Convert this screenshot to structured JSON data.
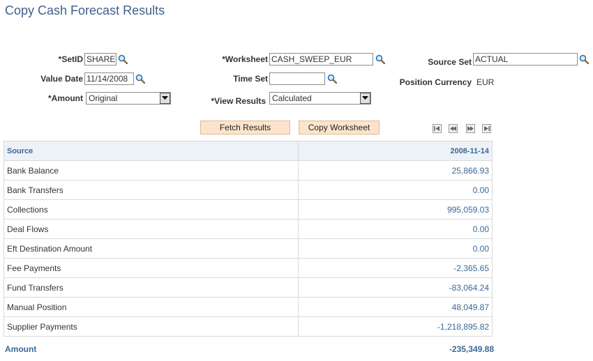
{
  "page": {
    "title": "Copy Cash Forecast Results"
  },
  "criteria": {
    "setid": {
      "label": "*SetID",
      "value": "SHARE"
    },
    "value_date": {
      "label": "Value Date",
      "value": "11/14/2008"
    },
    "amount": {
      "label": "*Amount",
      "value": "Original"
    },
    "worksheet": {
      "label": "*Worksheet",
      "value": "CASH_SWEEP_EUR"
    },
    "time_set": {
      "label": "Time Set",
      "value": ""
    },
    "view_results": {
      "label": "*View Results",
      "value": "Calculated"
    },
    "source_set": {
      "label": "Source Set",
      "value": "ACTUAL"
    },
    "position_currency": {
      "label": "Position Currency",
      "value": "EUR"
    }
  },
  "actions": {
    "fetch_label": "Fetch Results",
    "copy_label": "Copy Worksheet"
  },
  "grid": {
    "columns": {
      "source": "Source",
      "date": "2008-11-14"
    },
    "rows": [
      {
        "source": "Bank Balance",
        "amount": "25,866.93"
      },
      {
        "source": "Bank Transfers",
        "amount": "0.00"
      },
      {
        "source": "Collections",
        "amount": "995,059.03"
      },
      {
        "source": "Deal Flows",
        "amount": "0.00"
      },
      {
        "source": "Eft Destination Amount",
        "amount": "0.00"
      },
      {
        "source": "Fee Payments",
        "amount": "-2,365.65"
      },
      {
        "source": "Fund Transfers",
        "amount": "-83,064.24"
      },
      {
        "source": "Manual Position",
        "amount": "48,049.87"
      },
      {
        "source": "Supplier Payments",
        "amount": "-1,218,895.82"
      }
    ],
    "footer": {
      "label": "Amount",
      "total": "-235,349.88"
    }
  },
  "icons": {
    "lookup": "magnifier-icon",
    "dropdown": "triangle-down-icon",
    "nav_first": "first-page-icon",
    "nav_prev": "previous-page-icon",
    "nav_next": "next-page-icon",
    "nav_last": "last-page-icon"
  }
}
